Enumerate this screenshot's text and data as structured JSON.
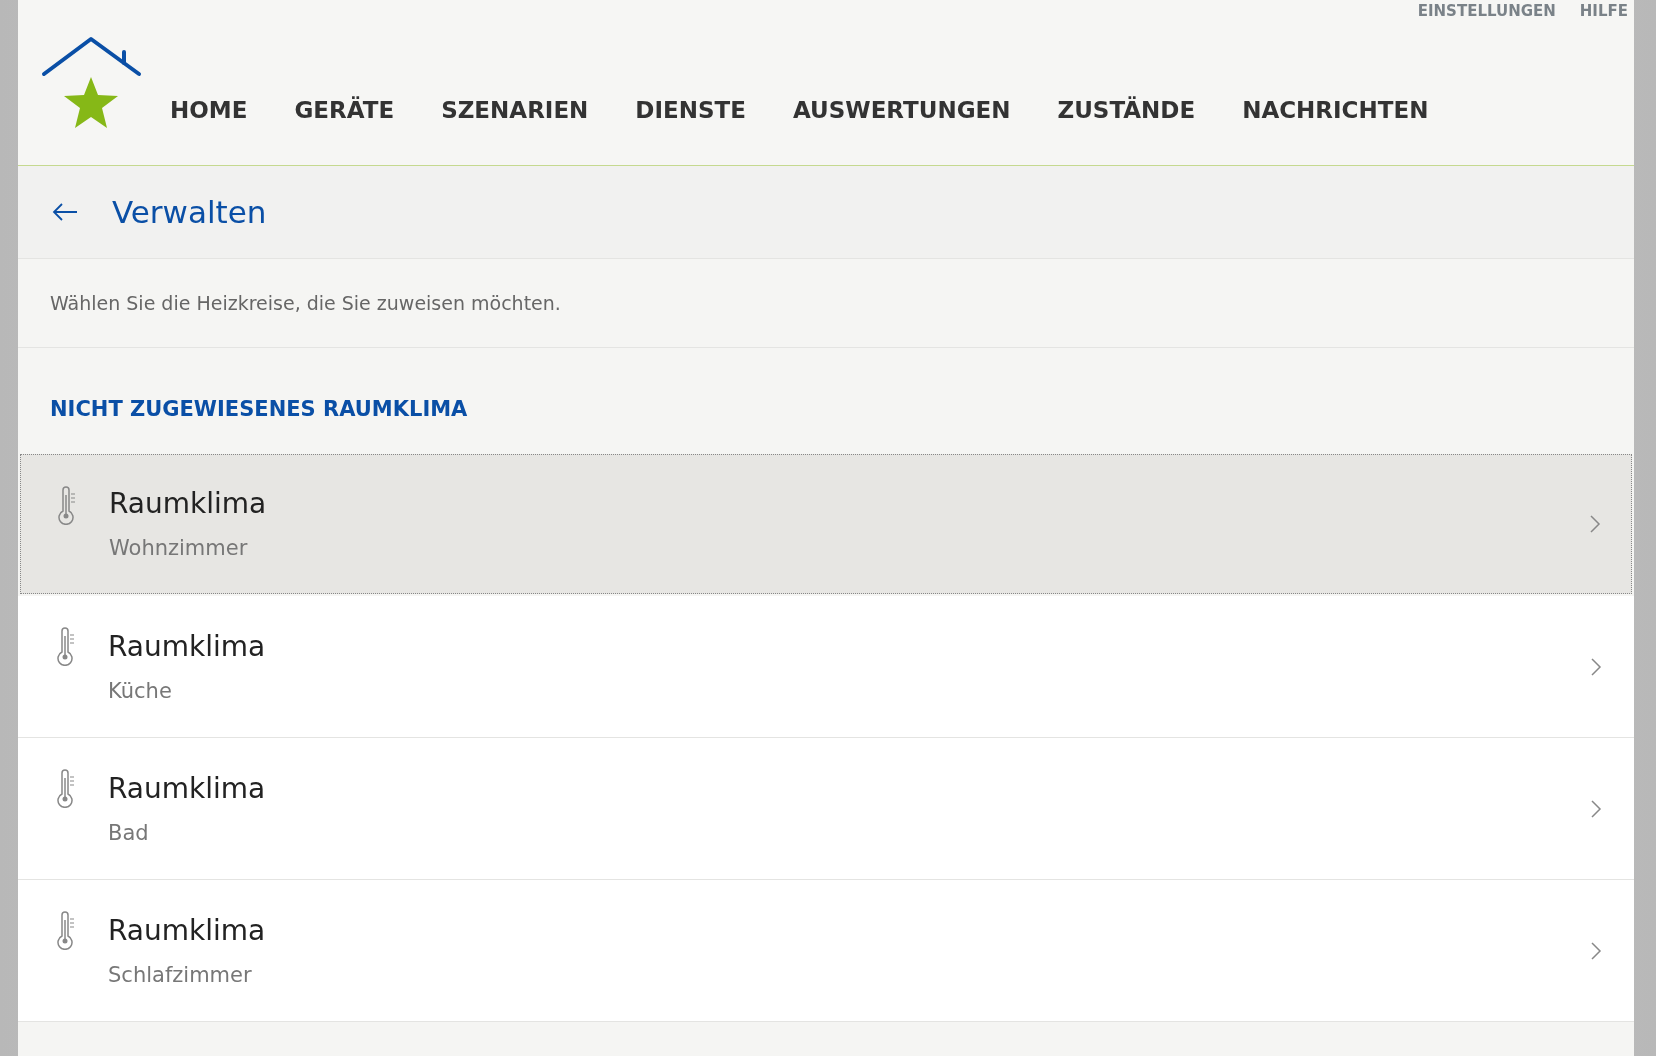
{
  "top_links": [
    "EINSTELLUNGEN",
    "HILFE"
  ],
  "nav": [
    "HOME",
    "GERÄTE",
    "SZENARIEN",
    "DIENSTE",
    "AUSWERTUNGEN",
    "ZUSTÄNDE",
    "NACHRICHTEN"
  ],
  "page_title": "Verwalten",
  "description": "Wählen Sie die Heizkreise, die Sie zuweisen möchten.",
  "section_heading": "NICHT ZUGEWIESENES RAUMKLIMA",
  "rooms": [
    {
      "title": "Raumklima",
      "subtitle": "Wohnzimmer",
      "selected": true
    },
    {
      "title": "Raumklima",
      "subtitle": "Küche",
      "selected": false
    },
    {
      "title": "Raumklima",
      "subtitle": "Bad",
      "selected": false
    },
    {
      "title": "Raumklima",
      "subtitle": "Schlafzimmer",
      "selected": false
    }
  ]
}
